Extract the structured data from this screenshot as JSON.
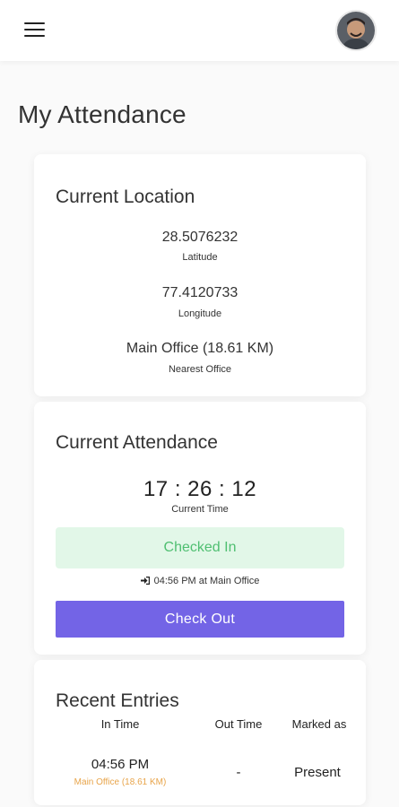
{
  "header": {
    "menu_icon": "hamburger-menu-icon",
    "avatar": "user-avatar"
  },
  "page": {
    "title": "My Attendance"
  },
  "location_card": {
    "title": "Current Location",
    "latitude_value": "28.5076232",
    "latitude_label": "Latitude",
    "longitude_value": "77.4120733",
    "longitude_label": "Longitude",
    "office_value": "Main Office (18.61 KM)",
    "office_label": "Nearest Office"
  },
  "attendance_card": {
    "title": "Current Attendance",
    "time": "17 : 26 : 12",
    "time_label": "Current Time",
    "status": "Checked In",
    "checkin_icon": "sign-in-icon",
    "checkin_info": "04:56 PM at Main Office",
    "checkout_label": "Check Out"
  },
  "entries_card": {
    "title": "Recent Entries",
    "columns": [
      "In Time",
      "Out Time",
      "Marked as"
    ],
    "rows": [
      {
        "in_time": "04:56 PM",
        "in_location": "Main Office (18.61 KM)",
        "out_time": "-",
        "marked_as": "Present"
      }
    ]
  },
  "colors": {
    "accent": "#7364e6",
    "success_bg": "#e2f7e8",
    "success_text": "#4fbf71",
    "location_text": "#e8a44a"
  }
}
